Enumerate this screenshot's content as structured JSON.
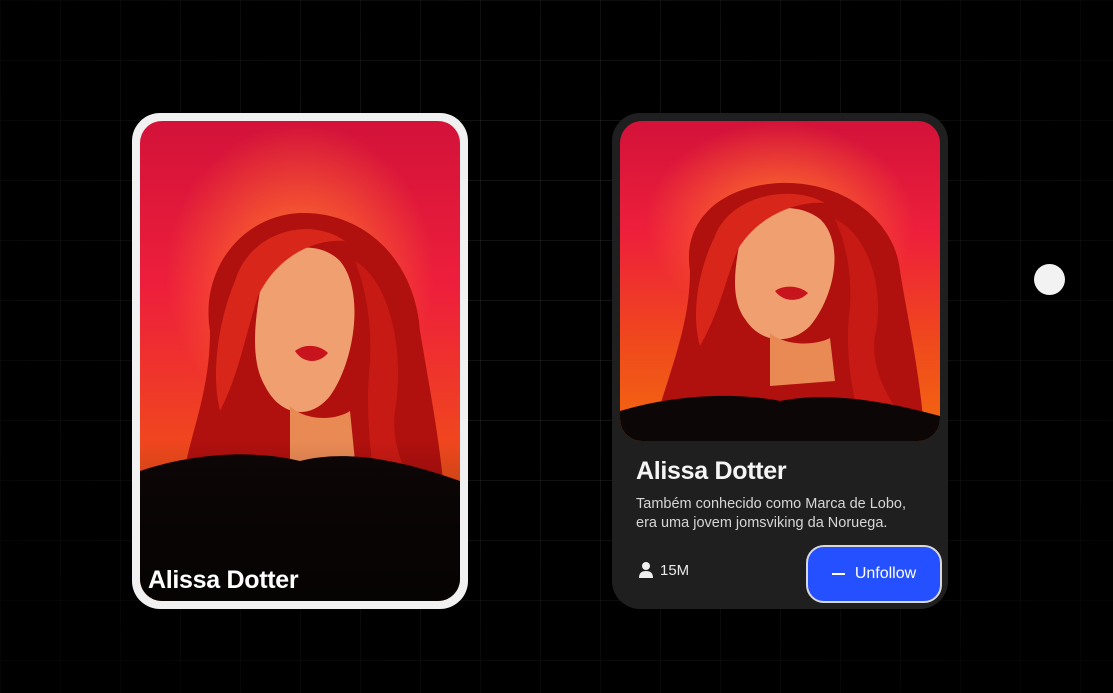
{
  "profile_card_compact": {
    "name": "Alissa Dotter"
  },
  "profile_card_detailed": {
    "name": "Alissa Dotter",
    "description": "Também conhecido como Marca de Lobo, era uma jovem jomsviking da Noruega.",
    "followers": "15M",
    "unfollow_label": "Unfollow",
    "icons": {
      "followers": "user-icon",
      "unfollow": "minus-icon"
    }
  },
  "colors": {
    "background": "#000000",
    "card_light_border": "#f1f1f1",
    "card_dark": "#1f1f1f",
    "button_blue": "#2450ff"
  }
}
